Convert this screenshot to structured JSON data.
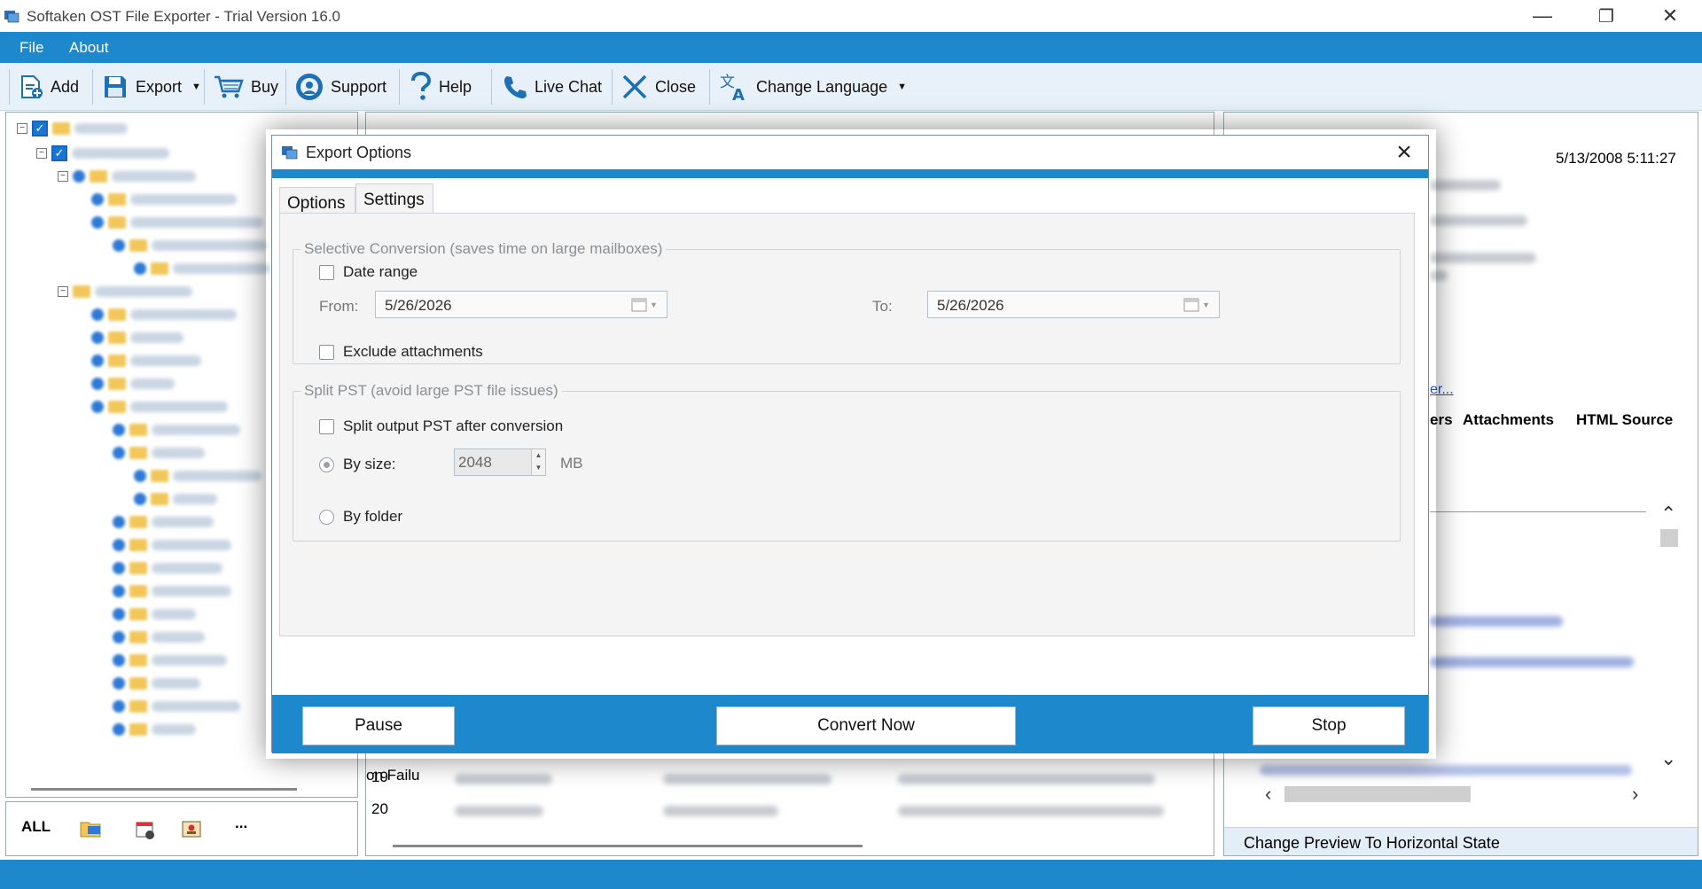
{
  "window": {
    "title": "Softaken OST File Exporter - Trial Version 16.0",
    "minimize": "—",
    "restore": "❐",
    "close": "✕"
  },
  "menu": {
    "file": "File",
    "about": "About"
  },
  "toolbar": {
    "add": "Add",
    "export": "Export",
    "buy": "Buy",
    "support": "Support",
    "help": "Help",
    "live_chat": "Live Chat",
    "close": "Close",
    "change_language": "Change Language"
  },
  "left_bottom": {
    "all": "ALL",
    "more": "..."
  },
  "middle": {
    "partial_text": "on Failu",
    "rows": [
      "19",
      "20"
    ]
  },
  "right": {
    "date": "5/13/2008 5:11:27",
    "partial_link": "er...",
    "tab_partial": "ers",
    "tab_attachments": "Attachments",
    "tab_html_source": "HTML Source",
    "preview_toggle": "Change Preview To Horizontal State"
  },
  "dialog": {
    "title": "Export Options",
    "tabs": {
      "options": "Options",
      "settings": "Settings"
    },
    "selective": {
      "legend": "Selective Conversion (saves time on large mailboxes)",
      "date_range": "Date range",
      "from_label": "From:",
      "from_value": "5/26/2026",
      "to_label": "To:",
      "to_value": "5/26/2026",
      "exclude_attachments": "Exclude attachments"
    },
    "split": {
      "legend": "Split PST (avoid large PST file issues)",
      "split_output": "Split output PST after conversion",
      "by_size": "By size:",
      "size_value": "2048",
      "size_unit": "MB",
      "by_folder": "By folder"
    },
    "buttons": {
      "pause": "Pause",
      "convert_now": "Convert Now",
      "stop": "Stop"
    }
  },
  "colors": {
    "accent": "#1e88cc",
    "toolbar_bg": "#e8f1fa",
    "checkbox_blue": "#1976d2"
  }
}
